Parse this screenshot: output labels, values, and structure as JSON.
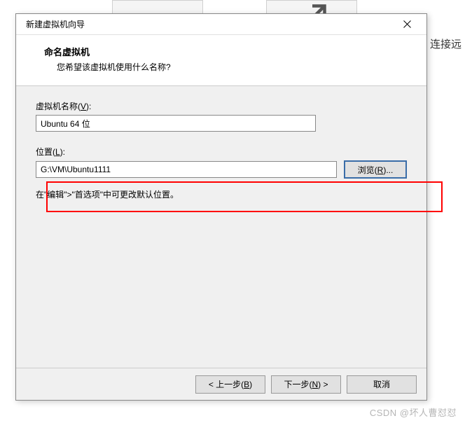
{
  "dialog": {
    "title": "新建虚拟机向导",
    "header": {
      "title": "命名虚拟机",
      "subtitle": "您希望该虚拟机使用什么名称?"
    },
    "name_field": {
      "label_prefix": "虚拟机名称(",
      "label_key": "V",
      "label_suffix": "):",
      "value": "Ubuntu 64 位"
    },
    "location_field": {
      "label_prefix": "位置(",
      "label_key": "L",
      "label_suffix": "):",
      "value": "G:\\VM\\Ubuntu1111"
    },
    "browse_btn": {
      "prefix": "浏览(",
      "key": "R",
      "suffix": ")..."
    },
    "hint": "在\"编辑\">\"首选项\"中可更改默认位置。",
    "buttons": {
      "back_prefix": "< 上一步(",
      "back_key": "B",
      "back_suffix": ")",
      "next_prefix": "下一步(",
      "next_key": "N",
      "next_suffix": ") >",
      "cancel": "取消"
    }
  },
  "background": {
    "text": "连接远"
  },
  "watermark": "CSDN @坏人曹怼怼"
}
